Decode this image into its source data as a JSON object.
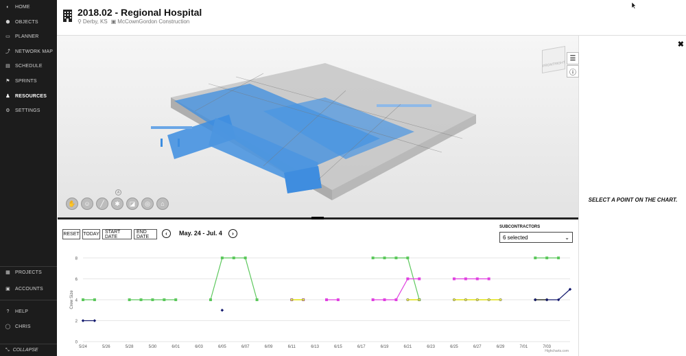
{
  "sidebar": {
    "items": [
      {
        "label": "HOME",
        "icon": "home-icon"
      },
      {
        "label": "OBJECTS",
        "icon": "objects-icon"
      },
      {
        "label": "PLANNER",
        "icon": "planner-icon"
      },
      {
        "label": "NETWORK MAP",
        "icon": "network-map-icon"
      },
      {
        "label": "SCHEDULE",
        "icon": "schedule-icon"
      },
      {
        "label": "SPRINTS",
        "icon": "sprints-icon"
      },
      {
        "label": "RESOURCES",
        "icon": "resources-icon",
        "active": true
      },
      {
        "label": "SETTINGS",
        "icon": "gear-icon"
      }
    ],
    "bottom_items": [
      {
        "label": "PROJECTS",
        "icon": "projects-icon"
      },
      {
        "label": "ACCOUNTS",
        "icon": "accounts-icon"
      },
      {
        "label": "HELP",
        "icon": "help-icon"
      },
      {
        "label": "CHRIS",
        "icon": "user-icon"
      }
    ],
    "collapse_label": "COLLAPSE"
  },
  "header": {
    "title": "2018.02 - Regional Hospital",
    "location": "Derby, KS",
    "company": "McCownGordon Construction"
  },
  "viewer": {
    "nav_cube_labels": [
      "FRONT",
      "RIGHT"
    ],
    "toolbar_icons": [
      "pan-icon",
      "walk-icon",
      "measure-icon",
      "explode-icon",
      "section-icon",
      "hide-icon",
      "home-view-icon"
    ]
  },
  "right_panel": {
    "message": "SELECT A POINT ON THE CHART."
  },
  "controls": {
    "reset": "RESET",
    "today": "TODAY",
    "start_date": "START DATE",
    "end_date": "END DATE",
    "range": "May. 24 - Jul. 4",
    "subcontractors_label": "SUBCONTRACTORS",
    "subcontractors_value": "6 selected"
  },
  "chart_data": {
    "type": "line",
    "ylabel": "Crew Size",
    "ylim": [
      0,
      8
    ],
    "yticks": [
      "0",
      "2",
      "4",
      "6",
      "8"
    ],
    "xlim": [
      0,
      42
    ],
    "xticks": [
      {
        "x": 0,
        "label": "5/24"
      },
      {
        "x": 2,
        "label": "5/26"
      },
      {
        "x": 4,
        "label": "5/28"
      },
      {
        "x": 6,
        "label": "5/30"
      },
      {
        "x": 8,
        "label": "6/01"
      },
      {
        "x": 10,
        "label": "6/03"
      },
      {
        "x": 12,
        "label": "6/05"
      },
      {
        "x": 14,
        "label": "6/07"
      },
      {
        "x": 16,
        "label": "6/09"
      },
      {
        "x": 18,
        "label": "6/11"
      },
      {
        "x": 20,
        "label": "6/13"
      },
      {
        "x": 22,
        "label": "6/15"
      },
      {
        "x": 24,
        "label": "6/17"
      },
      {
        "x": 26,
        "label": "6/19"
      },
      {
        "x": 28,
        "label": "6/21"
      },
      {
        "x": 30,
        "label": "6/23"
      },
      {
        "x": 32,
        "label": "6/25"
      },
      {
        "x": 34,
        "label": "6/27"
      },
      {
        "x": 36,
        "label": "6/29"
      },
      {
        "x": 38,
        "label": "7/01"
      },
      {
        "x": 40,
        "label": "7/03"
      }
    ],
    "credit": "Highcharts.com",
    "series": [
      {
        "color": "#5cc85c",
        "segments": [
          [
            [
              0,
              4
            ],
            [
              1,
              4
            ]
          ],
          [
            [
              4,
              4
            ],
            [
              5,
              4
            ],
            [
              6,
              4
            ],
            [
              7,
              4
            ],
            [
              8,
              4
            ]
          ],
          [
            [
              11,
              4
            ],
            [
              12,
              8
            ],
            [
              13,
              8
            ],
            [
              14,
              8
            ],
            [
              15,
              4
            ]
          ],
          [
            [
              25,
              8
            ],
            [
              26,
              8
            ],
            [
              27,
              8
            ],
            [
              28,
              8
            ],
            [
              29,
              4
            ]
          ],
          [
            [
              39,
              8
            ],
            [
              40,
              8
            ],
            [
              41,
              8
            ]
          ]
        ]
      },
      {
        "color": "#e040e0",
        "segments": [
          [
            [
              18,
              4
            ],
            [
              19,
              4
            ]
          ],
          [
            [
              21,
              4
            ],
            [
              22,
              4
            ]
          ],
          [
            [
              25,
              4
            ],
            [
              26,
              4
            ],
            [
              27,
              4
            ],
            [
              28,
              6
            ],
            [
              29,
              6
            ]
          ],
          [
            [
              32,
              6
            ],
            [
              33,
              6
            ],
            [
              34,
              6
            ],
            [
              35,
              6
            ]
          ]
        ]
      },
      {
        "color": "#e8e84a",
        "segments": [
          [
            [
              18,
              4
            ],
            [
              19,
              4
            ]
          ],
          [
            [
              28,
              4
            ],
            [
              29,
              4
            ]
          ],
          [
            [
              32,
              4
            ],
            [
              33,
              4
            ],
            [
              34,
              4
            ],
            [
              35,
              4
            ],
            [
              36,
              4
            ]
          ],
          [
            [
              39,
              4
            ],
            [
              40,
              4
            ]
          ]
        ]
      },
      {
        "color": "#141a6e",
        "segments": [
          [
            [
              0,
              2
            ],
            [
              1,
              2
            ]
          ],
          [
            [
              12,
              3
            ]
          ],
          [
            [
              39,
              4
            ],
            [
              40,
              4
            ],
            [
              41,
              4
            ],
            [
              42,
              5
            ]
          ]
        ]
      }
    ]
  }
}
